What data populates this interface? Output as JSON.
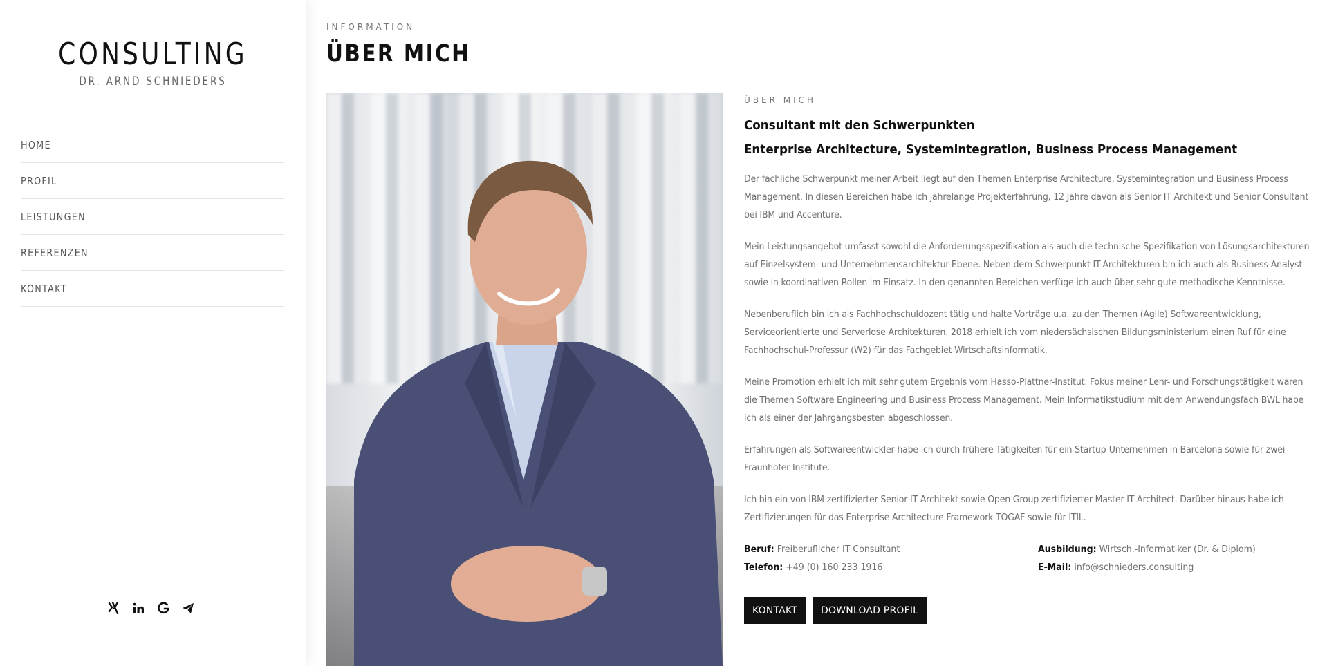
{
  "sidebar": {
    "logo_title": "CONSULTING",
    "logo_subtitle": "DR. ARND SCHNIEDERS",
    "nav": [
      {
        "label": "HOME"
      },
      {
        "label": "PROFIL"
      },
      {
        "label": "LEISTUNGEN"
      },
      {
        "label": "REFERENZEN"
      },
      {
        "label": "KONTAKT"
      }
    ],
    "social_icons": [
      "xing-icon",
      "linkedin-icon",
      "google-icon",
      "paper-plane-icon"
    ]
  },
  "main": {
    "eyebrow": "INFORMATION",
    "title": "ÜBER MICH",
    "photo": "portrait-photo",
    "section_eyebrow": "ÜBER MICH",
    "headline_1": "Consultant mit den Schwerpunkten",
    "headline_2": "Enterprise Architecture, Systemintegration, Business Process Management",
    "paragraphs": [
      "Der fachliche Schwerpunkt meiner Arbeit liegt auf den Themen Enterprise Architecture, Systemintegration und Business Process Management. In diesen Bereichen habe ich jahrelange Projekterfahrung, 12 Jahre davon als Senior IT Architekt und Senior Consultant bei IBM und Accenture.",
      "Mein Leistungsangebot umfasst sowohl die Anforderungsspezifikation als auch die technische Spezifikation von Lösungsarchitekturen auf Einzelsystem- und Unternehmensarchitektur-Ebene. Neben dem Schwerpunkt IT-Architekturen bin ich auch als Business-Analyst sowie in koordinativen Rollen im Einsatz. In den genannten Bereichen verfüge ich auch über sehr gute methodische Kenntnisse.",
      "Nebenberuflich bin ich als Fachhochschuldozent tätig und halte Vorträge u.a. zu den Themen (Agile) Softwareentwicklung, Serviceorientierte und Serverlose Architekturen. 2018 erhielt ich vom niedersächsischen Bildungsministerium einen Ruf für eine Fachhochschul-Professur (W2) für das Fachgebiet Wirtschaftsinformatik.",
      "Meine Promotion erhielt ich mit sehr gutem Ergebnis vom Hasso-Plattner-Institut. Fokus meiner Lehr- und Forschungstätigkeit waren die Themen Software Engineering und Business Process Management. Mein Informatikstudium mit dem Anwendungsfach BWL habe ich als einer der Jahrgangsbesten abgeschlossen.",
      "Erfahrungen als Softwareentwickler habe ich durch frühere Tätigkeiten für ein Startup-Unternehmen in Barcelona sowie für zwei Fraunhofer Institute.",
      "Ich bin ein von IBM zertifizierter Senior IT Architekt sowie Open Group zertifizierter Master IT Architect. Darüber hinaus habe ich Zertifizierungen für das Enterprise Architecture Framework TOGAF sowie für ITIL."
    ],
    "facts": {
      "beruf_label": "Beruf:",
      "beruf_value": "Freiberuflicher IT Consultant",
      "ausbildung_label": "Ausbildung:",
      "ausbildung_value": "Wirtsch.-Informatiker (Dr. & Diplom)",
      "telefon_label": "Telefon:",
      "telefon_value": "+49 (0) 160 233 1916",
      "email_label": "E-Mail:",
      "email_value": "info@schnieders.consulting"
    },
    "buttons": {
      "kontakt": "KONTAKT",
      "download": "DOWNLOAD PROFIL"
    }
  }
}
